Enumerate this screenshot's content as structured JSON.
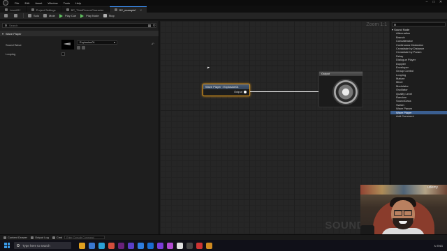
{
  "menu": [
    "File",
    "Edit",
    "Asset",
    "Window",
    "Tools",
    "Help"
  ],
  "window_controls": [
    "–",
    "□",
    "✕"
  ],
  "tabs": [
    {
      "label": "Level01*",
      "active": false
    },
    {
      "label": "Project Settings",
      "active": false
    },
    {
      "label": "BP_ThirdPersonCharacter",
      "active": false
    },
    {
      "label": "SC_example*",
      "active": true
    }
  ],
  "toolbar": {
    "buttons": [
      {
        "label": "",
        "icon": "save-icon"
      },
      {
        "label": "",
        "icon": "browse-icon"
      },
      {
        "label": "Solo",
        "icon": "solo-icon"
      },
      {
        "label": "Mute",
        "icon": "mute-icon"
      },
      {
        "label": "Play Cue",
        "icon": "play-icon"
      },
      {
        "label": "Play Node",
        "icon": "play-icon"
      },
      {
        "label": "Stop",
        "icon": "stop-icon"
      }
    ]
  },
  "details": {
    "search_placeholder": "Search",
    "category": "Wave Player",
    "sound_wave_label": "Sound Wave",
    "sound_wave_value": "Explosion01",
    "looping_label": "Looping"
  },
  "graph": {
    "zoom": "Zoom 1:1",
    "wave_node_title": "Wave Player : Explosion01",
    "wave_node_pin": "Output",
    "output_node_title": "Output",
    "watermark": "SOUND"
  },
  "palette": {
    "search_placeholder": "",
    "category": "Sound Node",
    "items": [
      "Attenuation",
      "Branch",
      "Concatenator",
      "Continuous Modulator",
      "Crossfade by Distance",
      "Crossfade by Param",
      "Delay",
      "Dialogue Player",
      "Doppler",
      "Enveloper",
      "Group Control",
      "Looping",
      "Mature",
      "Mixer",
      "Modulator",
      "Oscillator",
      "Quality Level",
      "Random",
      "SoundClass",
      "Switch",
      "Wave Param",
      "Wave Player",
      "Add Comment"
    ],
    "selected": "Wave Player"
  },
  "webcam": {
    "label": "udemy"
  },
  "statusbar": {
    "content_drawer": "Content Drawer",
    "output_log": "Output Log",
    "cmd": "Cmd",
    "cmd_placeholder": "Enter Console Command"
  },
  "taskbar": {
    "search_placeholder": "Type here to search",
    "icon_colors": [
      "#e0a020",
      "#3a78d0",
      "#2aa0d8",
      "#d24d3c",
      "#68217a",
      "#5a3fc8",
      "#2e7de0",
      "#1a6bd0",
      "#7a3cd8",
      "#b04ad0",
      "#e0e0e0",
      "#444444",
      "#cc3333",
      "#d08a20"
    ],
    "tray_text": "∧  ENG"
  },
  "colors": {
    "accent": "#3c8df0",
    "selected_node_border": "#d8931c",
    "palette_selection": "#3b5f91"
  }
}
